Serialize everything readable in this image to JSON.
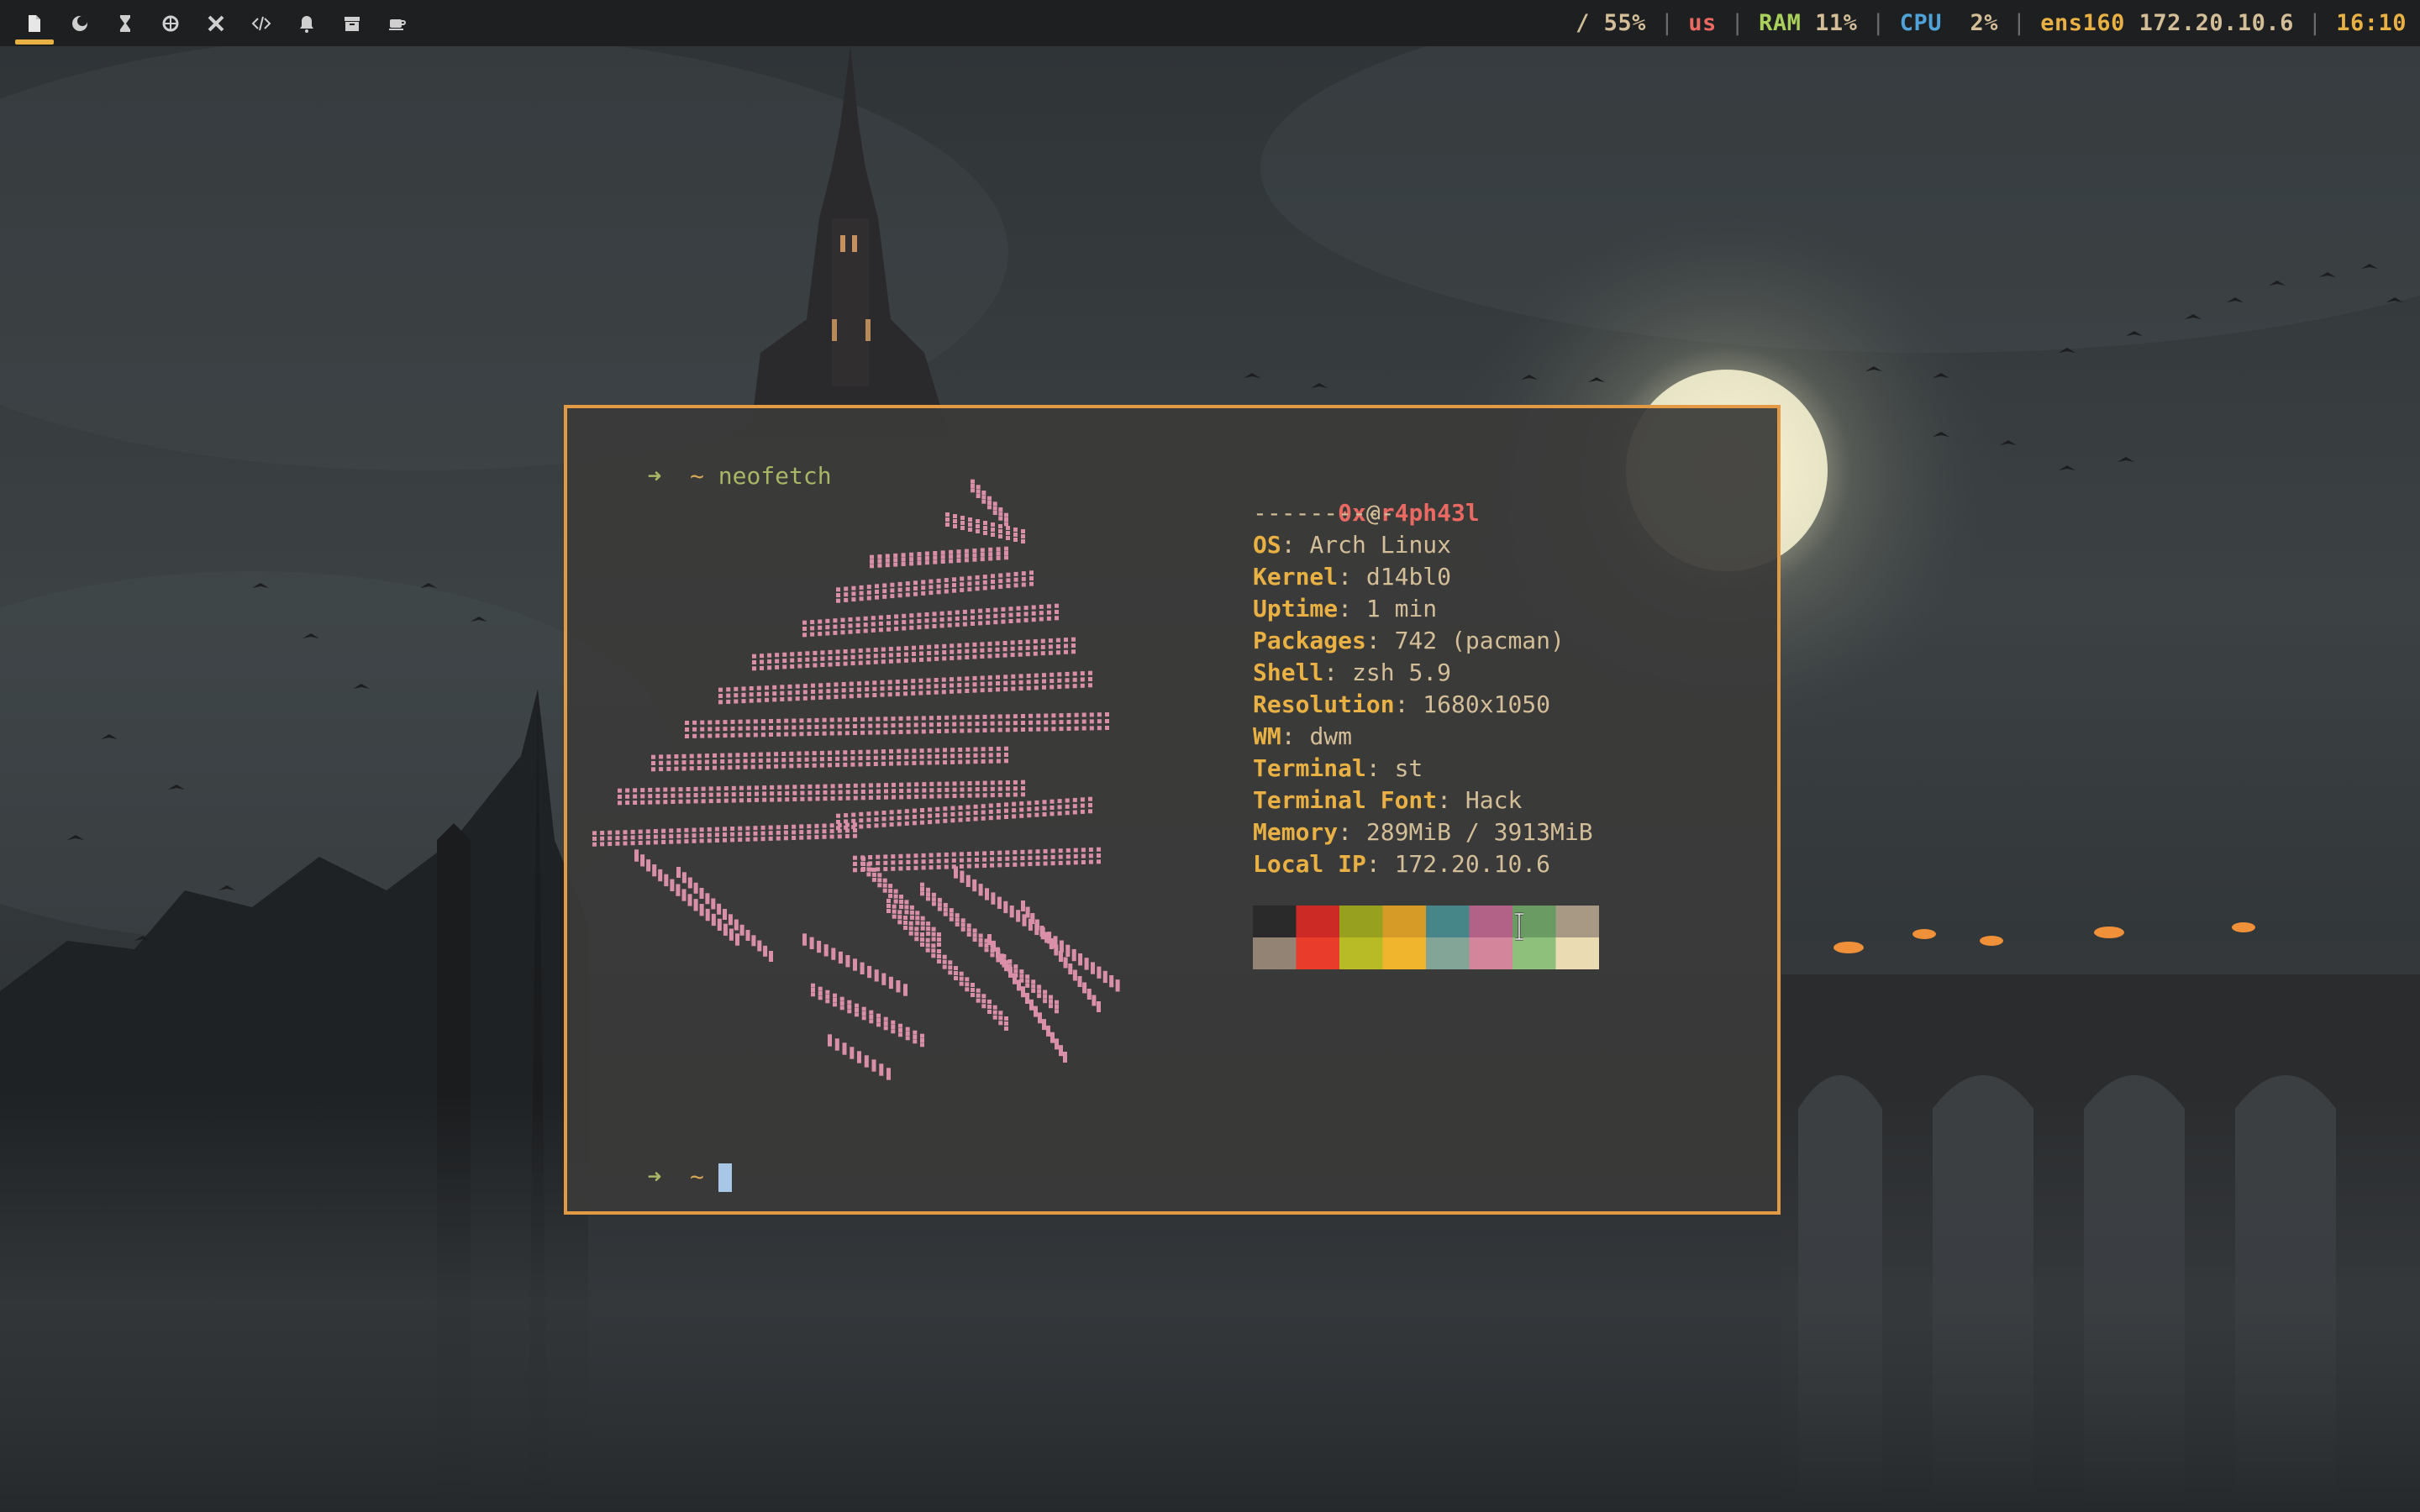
{
  "topbar": {
    "tags": [
      {
        "icon": "file-icon",
        "active": true
      },
      {
        "icon": "moon-icon",
        "active": false
      },
      {
        "icon": "hourglass-icon",
        "active": false
      },
      {
        "icon": "ship-icon",
        "active": false
      },
      {
        "icon": "tools-icon",
        "active": false
      },
      {
        "icon": "code-icon",
        "active": false
      },
      {
        "icon": "bell-icon",
        "active": false
      },
      {
        "icon": "archive-icon",
        "active": false
      },
      {
        "icon": "coffee-icon",
        "active": false
      }
    ],
    "status": {
      "disk_label": "/",
      "disk_value": "55%",
      "keyboard": "us",
      "ram_label": "RAM",
      "ram_value": "11%",
      "cpu_label": "CPU",
      "cpu_value": "2%",
      "net_label": "ens160",
      "net_value": "172.20.10.6",
      "time": "16:10",
      "separator": "|"
    },
    "colors": {
      "accent": "#e9b143",
      "disk": "#d4be98",
      "keyboard": "#ea6962",
      "ram": "#a9d05a",
      "cpu": "#4fa3d8",
      "net": "#e9b143",
      "time": "#e9b143"
    }
  },
  "terminal": {
    "prompt_arrow": "➜",
    "prompt_dir": "~",
    "command": "neofetch",
    "user": "0x",
    "at": "@",
    "host": "r4ph43l",
    "separator": "----------",
    "info": [
      {
        "key": "OS",
        "value": "Arch Linux"
      },
      {
        "key": "Kernel",
        "value": "d14bl0"
      },
      {
        "key": "Uptime",
        "value": "1 min"
      },
      {
        "key": "Packages",
        "value": "742 (pacman)"
      },
      {
        "key": "Shell",
        "value": "zsh 5.9"
      },
      {
        "key": "Resolution",
        "value": "1680x1050"
      },
      {
        "key": "WM",
        "value": "dwm"
      },
      {
        "key": "Terminal",
        "value": "st"
      },
      {
        "key": "Terminal Font",
        "value": "Hack"
      },
      {
        "key": "Memory",
        "value": "289MiB / 3913MiB"
      },
      {
        "key": "Local IP",
        "value": "172.20.10.6"
      }
    ],
    "palette": {
      "normal": [
        "#2a2a2a",
        "#cc2a24",
        "#98a01f",
        "#d69a26",
        "#468689",
        "#b16286",
        "#6a9b62",
        "#a89984"
      ],
      "bright": [
        "#928374",
        "#ea3c2b",
        "#b8bb26",
        "#f0b52c",
        "#83a598",
        "#d3869b",
        "#8ec07c",
        "#ebdbb2"
      ]
    },
    "art_color": "#d98fa8",
    "border_color": "#e29a45"
  }
}
